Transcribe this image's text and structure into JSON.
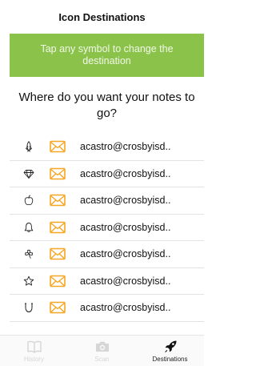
{
  "navbar": {
    "title": "Icon Destinations"
  },
  "banner": {
    "text": "Tap any symbol to change the destination"
  },
  "question": "Where do you want your notes to go?",
  "rows": [
    {
      "symbol": "rocket-outline-icon",
      "destination": "acastro@crosbyisd.."
    },
    {
      "symbol": "diamond-icon",
      "destination": "acastro@crosbyisd.."
    },
    {
      "symbol": "apple-icon",
      "destination": "acastro@crosbyisd.."
    },
    {
      "symbol": "bell-icon",
      "destination": "acastro@crosbyisd.."
    },
    {
      "symbol": "clover-icon",
      "destination": "acastro@crosbyisd.."
    },
    {
      "symbol": "star-icon",
      "destination": "acastro@crosbyisd.."
    },
    {
      "symbol": "horseshoe-icon",
      "destination": "acastro@crosbyisd.."
    }
  ],
  "envelope_icon": "envelope-icon",
  "colors": {
    "accent_green": "#8bc34a",
    "envelope_orange": "#f5a623"
  },
  "tabs": [
    {
      "label": "History",
      "icon": "book-icon",
      "active": false
    },
    {
      "label": "Scan",
      "icon": "camera-icon",
      "active": false
    },
    {
      "label": "Destinations",
      "icon": "rocket-icon",
      "active": true
    }
  ]
}
